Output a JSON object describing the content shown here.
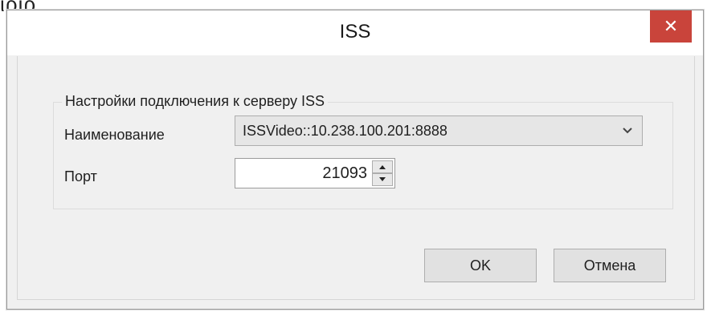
{
  "backdrop": {
    "fragment_text": "ιριρ"
  },
  "window": {
    "title": "ISS",
    "close_glyph": "✕"
  },
  "group": {
    "legend": "Настройки подключения к серверу ISS",
    "name_label": "Наименование",
    "name_value": "ISSVideo::10.238.100.201:8888",
    "port_label": "Порт",
    "port_value": "21093"
  },
  "buttons": {
    "ok": "OK",
    "cancel": "Отмена"
  },
  "icons": {
    "close": "close-icon",
    "dropdown": "chevron-down-icon",
    "spin_up": "arrow-up-icon",
    "spin_down": "arrow-down-icon"
  },
  "colors": {
    "close_button": "#c9443b",
    "window_bg": "#f0f0f0",
    "titlebar_bg": "#ffffff"
  }
}
